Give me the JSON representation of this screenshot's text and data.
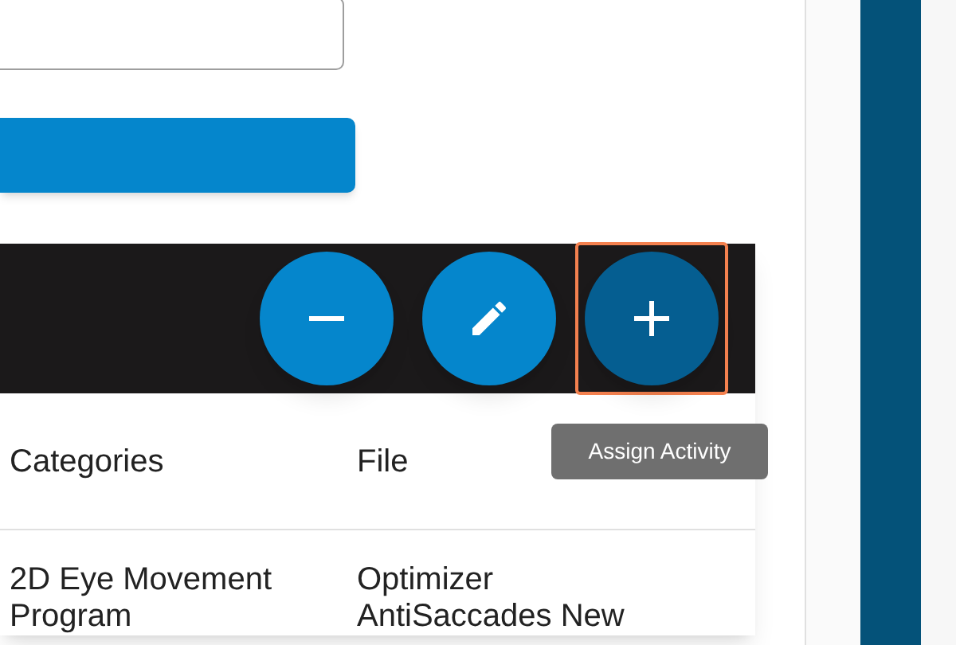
{
  "toolbar": {
    "buttons": [
      {
        "kind": "remove",
        "highlighted": false
      },
      {
        "kind": "edit",
        "highlighted": false
      },
      {
        "kind": "add",
        "highlighted": true
      }
    ]
  },
  "tooltip": "Assign Activity",
  "table": {
    "columns": [
      "Categories",
      "File"
    ],
    "rows": [
      {
        "cells": [
          "2D Eye Movement Program",
          "Optimizer AntiSaccades New"
        ]
      }
    ]
  }
}
